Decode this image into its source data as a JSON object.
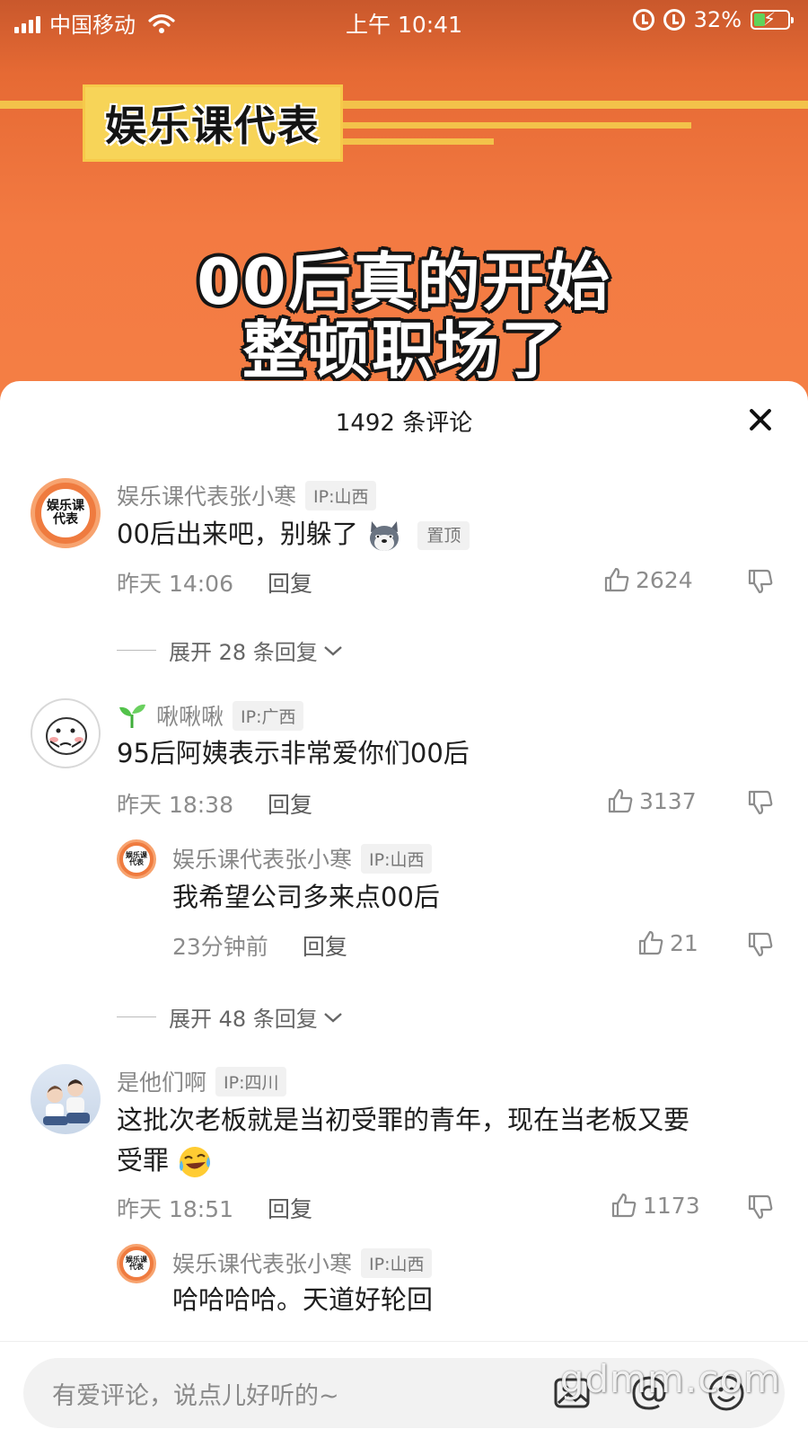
{
  "status_bar": {
    "carrier": "中国移动",
    "time": "上午 10:41",
    "battery": "32%",
    "battery_level": 0.32
  },
  "video": {
    "brand": "娱乐课代表",
    "title_line1": "00后真的开始",
    "title_line2": "整顿职场了"
  },
  "comments_panel": {
    "title": "1492 条评论",
    "comments": [
      {
        "username": "娱乐课代表张小寒",
        "ip": "IP:山西",
        "avatar_text": "娱乐课代表",
        "text": "00后出来吧，别躲了",
        "pin_label": "置顶",
        "emoji": "dog-face-emoji",
        "time": "昨天 14:06",
        "reply_label": "回复",
        "likes": "2624",
        "expand": "展开 28 条回复"
      },
      {
        "username": "啾啾啾",
        "ip": "IP:广西",
        "text": "95后阿姨表示非常爱你们00后",
        "time": "昨天 18:38",
        "reply_label": "回复",
        "likes": "3137",
        "reply": {
          "username": "娱乐课代表张小寒",
          "ip": "IP:山西",
          "avatar_text": "娱乐课代表",
          "text": "我希望公司多来点00后",
          "time": "23分钟前",
          "reply_label": "回复",
          "likes": "21"
        },
        "expand": "展开 48 条回复"
      },
      {
        "username": "是他们啊",
        "ip": "IP:四川",
        "text_line1": "这批次老板就是当初受罪的青年，现在当老板又要",
        "text_line2": "受罪",
        "emoji": "laughing-tears-emoji",
        "time": "昨天 18:51",
        "reply_label": "回复",
        "likes": "1173",
        "reply": {
          "username": "娱乐课代表张小寒",
          "ip": "IP:山西",
          "avatar_text": "娱乐课代表",
          "text": "哈哈哈哈。天道好轮回"
        }
      }
    ]
  },
  "input": {
    "placeholder": "有爱评论，说点儿好听的~"
  },
  "watermark": "gdmm.com",
  "colors": {
    "header_orange": "#f47f45",
    "brand_yellow": "#f7d458",
    "text_gray": "#888888"
  }
}
